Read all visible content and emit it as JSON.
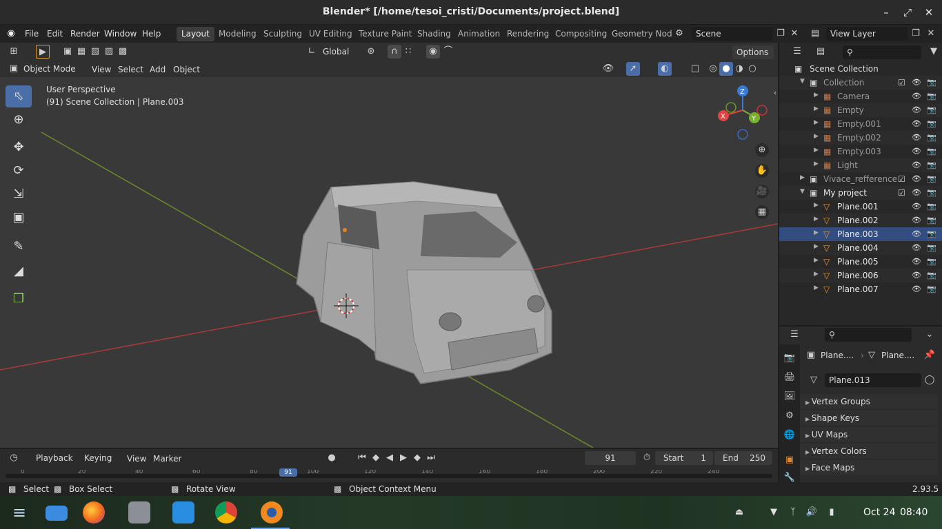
{
  "window": {
    "title": "Blender* [/home/tesoi_cristi/Documents/project.blend]"
  },
  "menu": {
    "file": "File",
    "edit": "Edit",
    "render": "Render",
    "window": "Window",
    "help": "Help"
  },
  "workspaces": [
    "Layout",
    "Modeling",
    "Sculpting",
    "UV Editing",
    "Texture Paint",
    "Shading",
    "Animation",
    "Rendering",
    "Compositing",
    "Geometry Nod"
  ],
  "scene": {
    "name": "Scene",
    "view_layer": "View Layer"
  },
  "header": {
    "orientation": "Global",
    "options": "Options",
    "mode": "Object Mode",
    "view": "View",
    "select": "Select",
    "add": "Add",
    "object": "Object"
  },
  "viewport": {
    "perspective": "User Perspective",
    "context": "(91) Scene Collection | Plane.003",
    "gizmo": {
      "x": "X",
      "y": "Y",
      "z": "Z"
    }
  },
  "outliner": {
    "root": "Scene Collection",
    "rows": [
      {
        "label": "Collection",
        "indent": 1
      },
      {
        "label": "Camera",
        "indent": 2
      },
      {
        "label": "Empty",
        "indent": 2
      },
      {
        "label": "Empty.001",
        "indent": 2
      },
      {
        "label": "Empty.002",
        "indent": 2
      },
      {
        "label": "Empty.003",
        "indent": 2
      },
      {
        "label": "Light",
        "indent": 2
      },
      {
        "label": "Vivace_refference",
        "indent": 1
      },
      {
        "label": "My project",
        "indent": 1
      },
      {
        "label": "Plane.001",
        "indent": 2
      },
      {
        "label": "Plane.002",
        "indent": 2
      },
      {
        "label": "Plane.003",
        "indent": 2
      },
      {
        "label": "Plane.004",
        "indent": 2
      },
      {
        "label": "Plane.005",
        "indent": 2
      },
      {
        "label": "Plane.006",
        "indent": 2
      },
      {
        "label": "Plane.007",
        "indent": 2
      }
    ]
  },
  "properties": {
    "breadcrumb_obj": "Plane....",
    "breadcrumb_data": "Plane....",
    "mesh_name": "Plane.013",
    "panels": [
      "Vertex Groups",
      "Shape Keys",
      "UV Maps",
      "Vertex Colors",
      "Face Maps"
    ]
  },
  "timeline": {
    "playback": "Playback",
    "keying": "Keying",
    "view": "View",
    "marker": "Marker",
    "current_frame": "91",
    "start_label": "Start",
    "start": "1",
    "end_label": "End",
    "end": "250",
    "ruler": [
      "0",
      "20",
      "40",
      "60",
      "80",
      "100",
      "120",
      "140",
      "160",
      "180",
      "200",
      "220",
      "240"
    ]
  },
  "status": {
    "select": "Select",
    "box_select": "Box Select",
    "rotate_view": "Rotate View",
    "context_menu": "Object Context Menu",
    "version": "2.93.5"
  },
  "taskbar": {
    "date": "Oct 24",
    "time": "08:40"
  }
}
